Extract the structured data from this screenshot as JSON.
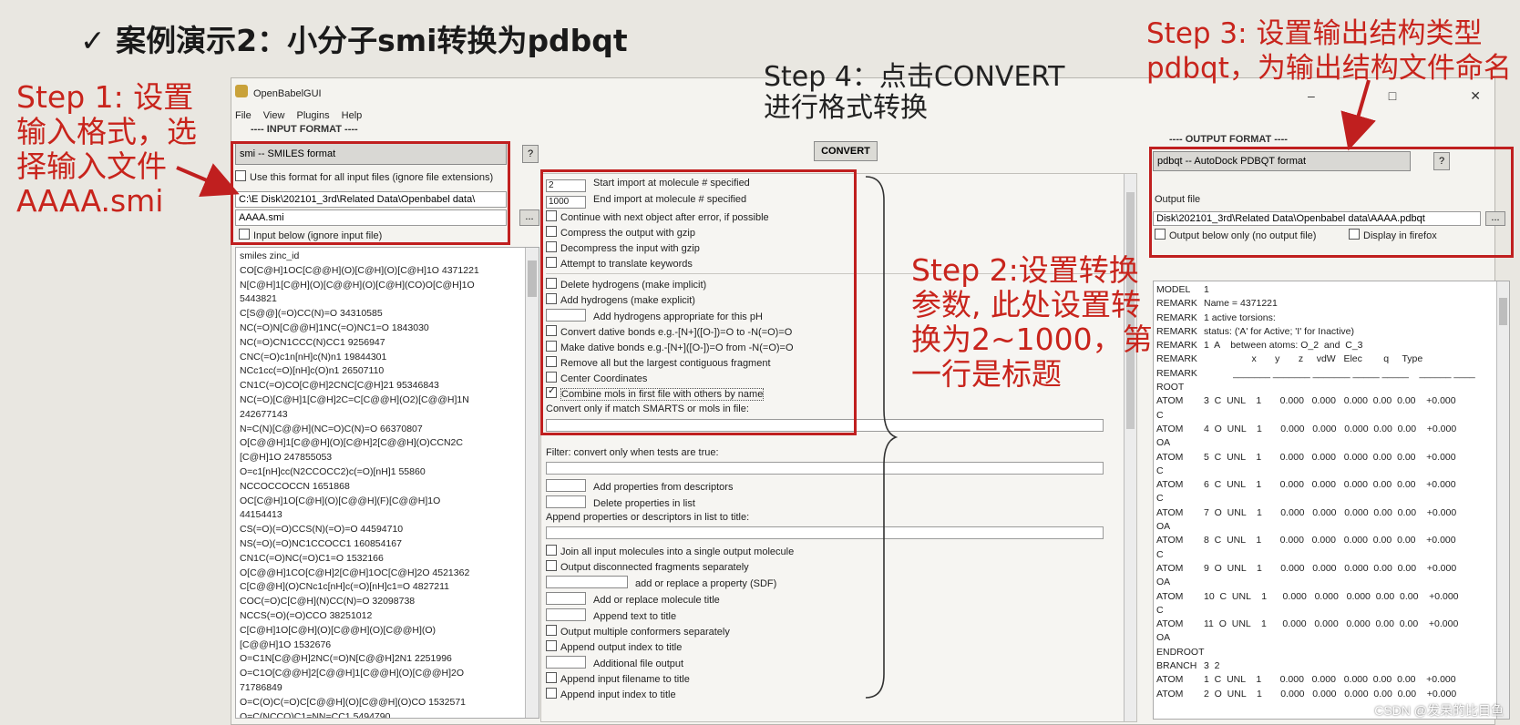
{
  "slide": {
    "title": "✓ 案例演示2：小分子smi转换为pdbqt",
    "step1": [
      "Step 1: 设置",
      "输入格式，选",
      "择输入文件",
      "AAAA.smi"
    ],
    "step2": [
      "Step 2:设置转换",
      "参数, 此处设置转",
      "换为2~1000，第",
      "一行是标题"
    ],
    "step3": [
      "Step 3: 设置输出结构类型",
      "pdbqt，为输出结构文件命名"
    ],
    "step4": [
      "Step 4：点击CONVERT",
      "进行格式转换"
    ],
    "watermark": "CSDN @发呆的比目鱼",
    "annotation_color": "#c8241c"
  },
  "window": {
    "title": "OpenBabelGUI",
    "menu": [
      "File",
      "View",
      "Plugins",
      "Help"
    ],
    "controls": [
      "–",
      "□",
      "✕"
    ]
  },
  "input": {
    "header": "---- INPUT FORMAT ----",
    "format": "smi -- SMILES format",
    "help_btn": "?",
    "use_for_all": "Use this format for all input files (ignore file extensions)",
    "path": "C:\\E Disk\\202101_3rd\\Related Data\\Openbabel data\\",
    "file": "AAAA.smi",
    "browse": "...",
    "input_below": "Input below (ignore input file)",
    "lines": [
      "smiles zinc_id",
      "CO[C@H]1OC[C@@H](O)[C@H](O)[C@H]1O 4371221",
      "N[C@H]1[C@H](O)[C@@H](O)[C@H](CO)O[C@H]1O",
      "5443821",
      "C[S@@](=O)CC(N)=O 34310585",
      "NC(=O)N[C@@H]1NC(=O)NC1=O 1843030",
      "NC(=O)CN1CCC(N)CC1 9256947",
      "CNC(=O)c1n[nH]c(N)n1 19844301",
      "NCc1cc(=O)[nH]c(O)n1 26507110",
      "CN1C(=O)CO[C@H]2CNC[C@H]21 95346843",
      "NC(=O)[C@H]1[C@H]2C=C[C@@H](O2)[C@@H]1N",
      "242677143",
      "N=C(N)[C@@H](NC=O)C(N)=O 66370807",
      "O[C@@H]1[C@@H](O)[C@H]2[C@@H](O)CCN2C",
      "[C@H]1O 247855053",
      "O=c1[nH]cc(N2CCOCC2)c(=O)[nH]1 55860",
      "NCCOCCOCCN 1651868",
      "OC[C@H]1O[C@H](O)[C@@H](F)[C@@H]1O",
      "44154413",
      "CS(=O)(=O)CCS(N)(=O)=O 44594710",
      "NS(=O)(=O)NC1CCOCC1 160854167",
      "CN1C(=O)NC(=O)C1=O 1532166",
      "O[C@@H]1CO[C@H]2[C@H]1OC[C@H]2O 4521362",
      "C[C@@H](O)CNc1c[nH]c(=O)[nH]c1=O 4827211",
      "COC(=O)C[C@H](N)CC(N)=O 32098738",
      "NCCS(=O)(=O)CCO 38251012",
      "C[C@H]1O[C@H](O)[C@@H](O)[C@@H](O)",
      "[C@@H]1O 1532676",
      "O=C1N[C@@H]2NC(=O)N[C@@H]2N1 2251996",
      "O=C1O[C@@H]2[C@@H]1[C@@H](O)[C@@H]2O",
      "71786849",
      "O=C(O)C(=O)C[C@@H](O)[C@@H](O)CO 1532571",
      "O=C(NCCO)C1=NN=CC1 5494790"
    ]
  },
  "convert": {
    "label": "CONVERT"
  },
  "options": {
    "start_value": "2",
    "start_label": "Start import at molecule # specified",
    "end_value": "1000",
    "end_label": "End import at molecule # specified",
    "checks": [
      "Continue with next object after error, if possible",
      "Compress the output with gzip",
      "Decompress the input with gzip",
      "Attempt to translate keywords"
    ],
    "checks2": [
      "Delete hydrogens (make implicit)",
      "Add hydrogens (make explicit)"
    ],
    "ph_label": "Add hydrogens appropriate for this pH",
    "checks3": [
      "Convert dative bonds e.g.-[N+]([O-])=O to -N(=O)=O",
      "Make dative bonds e.g.-[N+]([O-])=O from -N(=O)=O",
      "Remove all but the largest contiguous fragment",
      "Center Coordinates"
    ],
    "combine": "Combine mols in first file with others by name",
    "convert_only": "Convert only if match SMARTS or mols in file:",
    "filter_label": "Filter: convert only when tests are true:",
    "add_props": "Add properties from descriptors",
    "delete_props": "Delete properties in list",
    "append_props": "Append properties or descriptors in list to title:",
    "lower": [
      "Join all input molecules into a single output molecule",
      "Output disconnected fragments separately"
    ],
    "add_replace": "add or replace a property (SDF)",
    "replace_title": "Add or replace molecule title",
    "append_text": "Append text to title",
    "lower2": [
      "Output multiple conformers separately",
      "Append output index to title"
    ],
    "additional": "Additional file output",
    "lower3": [
      "Append input filename to title",
      "Append input index to title"
    ]
  },
  "output": {
    "header": "---- OUTPUT FORMAT ----",
    "format": "pdbqt -- AutoDock PDBQT format",
    "help_btn": "?",
    "file_label": "Output file",
    "path": "Disk\\202101_3rd\\Related Data\\Openbabel data\\AAAA.pdbqt",
    "browse": "...",
    "output_below": "Output below only (no output file)",
    "firefox": "Display in firefox",
    "lines": [
      [
        "MODEL",
        "1"
      ],
      [
        "REMARK",
        "Name = 4371221"
      ],
      [
        "REMARK",
        "1 active torsions:"
      ],
      [
        "REMARK",
        "status: ('A' for Active; 'I' for Inactive)"
      ],
      [
        "REMARK",
        "1  A    between atoms: O_2  and  C_3"
      ],
      [
        "REMARK",
        "                  x       y       z     vdW   Elec        q     Type"
      ],
      [
        "REMARK",
        "           _______ _______ _______ _____ _____    ______ ____"
      ],
      [
        "ROOT",
        ""
      ],
      [
        "ATOM",
        "3  C  UNL    1       0.000   0.000   0.000  0.00  0.00    +0.000"
      ],
      [
        "C",
        ""
      ],
      [
        "ATOM",
        "4  O  UNL    1       0.000   0.000   0.000  0.00  0.00    +0.000"
      ],
      [
        "OA",
        ""
      ],
      [
        "ATOM",
        "5  C  UNL    1       0.000   0.000   0.000  0.00  0.00    +0.000"
      ],
      [
        "C",
        ""
      ],
      [
        "ATOM",
        "6  C  UNL    1       0.000   0.000   0.000  0.00  0.00    +0.000"
      ],
      [
        "C",
        ""
      ],
      [
        "ATOM",
        "7  O  UNL    1       0.000   0.000   0.000  0.00  0.00    +0.000"
      ],
      [
        "OA",
        ""
      ],
      [
        "ATOM",
        "8  C  UNL    1       0.000   0.000   0.000  0.00  0.00    +0.000"
      ],
      [
        "C",
        ""
      ],
      [
        "ATOM",
        "9  O  UNL    1       0.000   0.000   0.000  0.00  0.00    +0.000"
      ],
      [
        "OA",
        ""
      ],
      [
        "ATOM",
        "10  C  UNL    1      0.000   0.000   0.000  0.00  0.00    +0.000"
      ],
      [
        "C",
        ""
      ],
      [
        "ATOM",
        "11  O  UNL    1      0.000   0.000   0.000  0.00  0.00    +0.000"
      ],
      [
        "OA",
        ""
      ],
      [
        "ENDROOT",
        ""
      ],
      [
        "BRANCH",
        "3  2"
      ],
      [
        "ATOM",
        "1  C  UNL    1       0.000   0.000   0.000  0.00  0.00    +0.000"
      ],
      [
        "ATOM",
        "2  O  UNL    1       0.000   0.000   0.000  0.00  0.00    +0.000"
      ]
    ]
  }
}
